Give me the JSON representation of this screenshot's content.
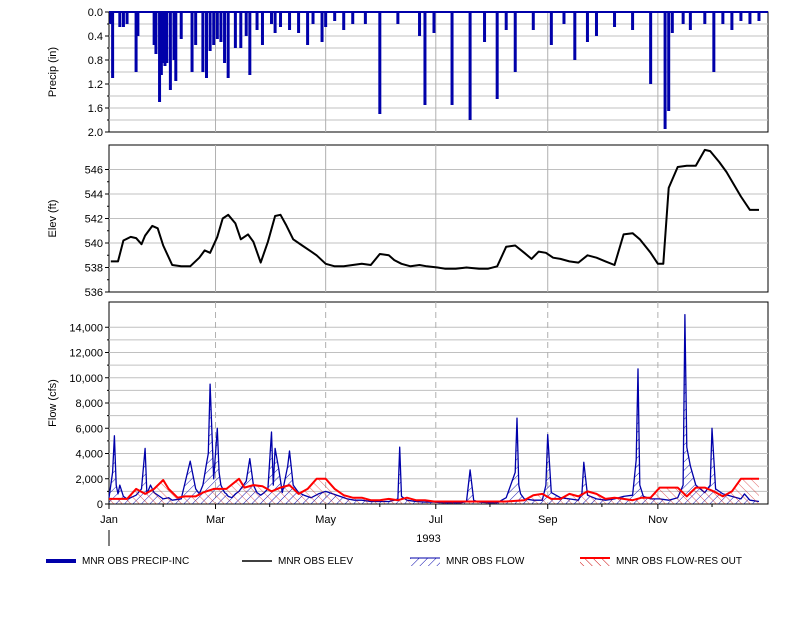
{
  "chart_data": [
    {
      "type": "bar",
      "panel": "precip",
      "ylabel": "Precip (in)",
      "ylim": [
        0,
        2.0
      ],
      "yticks": [
        "0.0",
        "0.4",
        "0.8",
        "1.2",
        "1.6",
        "2.0"
      ],
      "inverted": true,
      "color": "#0000aa",
      "series": [
        {
          "name": "MNR OBS PRECIP-INC",
          "x": [
            1,
            2,
            6,
            8,
            10,
            15,
            16,
            25,
            26,
            28,
            29,
            30,
            31,
            32,
            34,
            36,
            37,
            40,
            46,
            48,
            52,
            54,
            56,
            58,
            60,
            62,
            64,
            66,
            70,
            73,
            76,
            78,
            82,
            85,
            90,
            92,
            95,
            100,
            105,
            110,
            113,
            118,
            120,
            125,
            130,
            135,
            142,
            150,
            160,
            172,
            175,
            180,
            190,
            200,
            208,
            215,
            220,
            225,
            235,
            245,
            252,
            258,
            265,
            270,
            280,
            290,
            300,
            308,
            310,
            312,
            318,
            322,
            330,
            335,
            340,
            345,
            350,
            355,
            360
          ],
          "y": [
            0.2,
            1.1,
            0.25,
            0.25,
            0.2,
            1.0,
            0.4,
            0.55,
            0.7,
            1.5,
            1.05,
            0.85,
            0.9,
            0.85,
            1.3,
            0.8,
            1.15,
            0.45,
            1.0,
            0.55,
            1.0,
            1.1,
            0.65,
            0.55,
            0.45,
            0.5,
            0.85,
            1.1,
            0.6,
            0.6,
            0.4,
            1.05,
            0.3,
            0.55,
            0.2,
            0.35,
            0.25,
            0.3,
            0.35,
            0.55,
            0.2,
            0.5,
            0.25,
            0.15,
            0.3,
            0.2,
            0.2,
            1.7,
            0.2,
            0.4,
            1.55,
            0.35,
            1.55,
            1.8,
            0.5,
            1.45,
            0.3,
            1.0,
            0.3,
            0.55,
            0.2,
            0.8,
            0.5,
            0.4,
            0.25,
            0.3,
            1.2,
            1.95,
            1.65,
            0.35,
            0.2,
            0.3,
            0.2,
            1.0,
            0.2,
            0.3,
            0.15,
            0.2,
            0.15
          ]
        }
      ]
    },
    {
      "type": "line",
      "panel": "elev",
      "ylabel": "Elev (ft)",
      "ylim": [
        536,
        548
      ],
      "yticks": [
        "536",
        "538",
        "540",
        "542",
        "544",
        "546"
      ],
      "color": "#000000",
      "series": [
        {
          "name": "MNR OBS ELEV",
          "x": [
            1,
            5,
            8,
            12,
            15,
            18,
            20,
            24,
            27,
            30,
            35,
            40,
            45,
            50,
            53,
            56,
            60,
            63,
            66,
            70,
            73,
            77,
            80,
            84,
            88,
            92,
            95,
            98,
            102,
            107,
            112,
            115,
            120,
            125,
            130,
            135,
            140,
            145,
            150,
            155,
            158,
            162,
            167,
            172,
            176,
            182,
            186,
            192,
            198,
            205,
            210,
            215,
            220,
            225,
            230,
            234,
            238,
            242,
            246,
            250,
            255,
            260,
            265,
            270,
            275,
            280,
            285,
            290,
            294,
            300,
            304,
            307,
            310,
            315,
            320,
            325,
            330,
            333,
            338,
            342,
            346,
            350,
            355,
            360
          ],
          "y": [
            538.5,
            538.5,
            540.2,
            540.5,
            540.4,
            539.9,
            540.6,
            541.4,
            541.2,
            539.8,
            538.2,
            538.1,
            538.1,
            538.8,
            539.4,
            539.2,
            540.5,
            542.0,
            542.3,
            541.6,
            540.3,
            540.7,
            540.1,
            538.4,
            540.1,
            542.2,
            542.3,
            541.5,
            540.3,
            539.8,
            539.3,
            539.0,
            538.3,
            538.1,
            538.1,
            538.2,
            538.3,
            538.2,
            539.1,
            539.0,
            538.6,
            538.3,
            538.1,
            538.2,
            538.1,
            538.0,
            537.9,
            537.9,
            538.0,
            537.9,
            537.9,
            538.1,
            539.7,
            539.8,
            539.2,
            538.7,
            539.3,
            539.2,
            538.8,
            538.7,
            538.5,
            538.4,
            539.0,
            538.8,
            538.5,
            538.2,
            540.7,
            540.8,
            540.3,
            539.2,
            538.3,
            538.3,
            544.5,
            546.2,
            546.3,
            546.3,
            547.6,
            547.5,
            546.6,
            545.8,
            544.8,
            543.8,
            542.7,
            542.7
          ]
        }
      ]
    },
    {
      "type": "line",
      "panel": "flow",
      "ylabel": "Flow (cfs)",
      "ylim": [
        0,
        16000
      ],
      "yticks": [
        "0",
        "2,000",
        "4,000",
        "6,000",
        "8,000",
        "10,000",
        "12,000",
        "14,000"
      ],
      "xticks": [
        {
          "label": "Jan",
          "day": 0
        },
        {
          "label": "Mar",
          "day": 59
        },
        {
          "label": "May",
          "day": 120
        },
        {
          "label": "Jul",
          "day": 181
        },
        {
          "label": "Sep",
          "day": 243
        },
        {
          "label": "Nov",
          "day": 304
        }
      ],
      "xlabel": "1993",
      "series": [
        {
          "name": "MNR OBS FLOW",
          "color": "#0000aa",
          "x": [
            0,
            2,
            3,
            4,
            5,
            6,
            8,
            10,
            12,
            15,
            18,
            20,
            21,
            23,
            25,
            28,
            30,
            33,
            35,
            40,
            45,
            48,
            50,
            52,
            54,
            55,
            56,
            58,
            60,
            61,
            62,
            63,
            64,
            65,
            66,
            68,
            70,
            72,
            76,
            78,
            80,
            82,
            84,
            86,
            88,
            90,
            91,
            92,
            94,
            96,
            99,
            100,
            102,
            105,
            108,
            112,
            116,
            120,
            124,
            128,
            132,
            136,
            140,
            145,
            150,
            155,
            158,
            160,
            161,
            162,
            165,
            170,
            175,
            180,
            185,
            190,
            195,
            198,
            200,
            202,
            205,
            210,
            215,
            220,
            225,
            226,
            227,
            228,
            230,
            235,
            240,
            242,
            243,
            245,
            250,
            255,
            260,
            262,
            263,
            265,
            270,
            275,
            280,
            285,
            290,
            292,
            293,
            294,
            296,
            300,
            305,
            310,
            315,
            318,
            319,
            320,
            322,
            325,
            330,
            333,
            334,
            336,
            340,
            345,
            350,
            352,
            355,
            360
          ],
          "y": [
            500,
            2500,
            5400,
            1500,
            800,
            1500,
            600,
            400,
            500,
            700,
            1200,
            4400,
            800,
            1500,
            900,
            600,
            400,
            500,
            300,
            400,
            3400,
            1200,
            800,
            1500,
            3200,
            4000,
            9500,
            2000,
            6000,
            2500,
            1500,
            1200,
            900,
            800,
            600,
            500,
            800,
            1000,
            1800,
            3600,
            1500,
            900,
            700,
            900,
            1200,
            5700,
            1500,
            4400,
            2800,
            900,
            3000,
            4200,
            1500,
            900,
            700,
            500,
            800,
            1000,
            800,
            600,
            400,
            300,
            300,
            200,
            200,
            200,
            300,
            400,
            4500,
            600,
            300,
            200,
            150,
            150,
            100,
            100,
            100,
            200,
            2700,
            300,
            150,
            100,
            100,
            500,
            2500,
            6800,
            1500,
            800,
            400,
            300,
            300,
            1500,
            5500,
            900,
            500,
            400,
            300,
            900,
            3300,
            700,
            400,
            300,
            400,
            600,
            700,
            3500,
            10700,
            1500,
            600,
            400,
            400,
            300,
            500,
            1500,
            15000,
            4500,
            3000,
            1500,
            900,
            1500,
            6000,
            1200,
            800,
            600,
            400,
            800,
            300,
            200
          ],
          "hatched": true
        },
        {
          "name": "MNR OBS FLOW-RES OUT",
          "color": "#ff0000",
          "x": [
            0,
            10,
            15,
            20,
            25,
            30,
            33,
            38,
            42,
            48,
            52,
            58,
            65,
            72,
            75,
            80,
            85,
            90,
            95,
            100,
            105,
            110,
            115,
            120,
            125,
            130,
            135,
            140,
            145,
            150,
            155,
            160,
            165,
            170,
            175,
            180,
            190,
            200,
            210,
            220,
            230,
            235,
            240,
            245,
            250,
            255,
            260,
            265,
            270,
            275,
            280,
            285,
            290,
            295,
            300,
            305,
            310,
            315,
            320,
            325,
            330,
            335,
            340,
            345,
            350,
            355,
            360
          ],
          "y": [
            400,
            400,
            1200,
            800,
            1200,
            1900,
            1200,
            500,
            600,
            600,
            900,
            1200,
            1200,
            2000,
            1300,
            1500,
            1400,
            1000,
            1300,
            1500,
            800,
            1200,
            2000,
            2000,
            1200,
            700,
            500,
            500,
            300,
            300,
            400,
            300,
            500,
            300,
            300,
            200,
            200,
            200,
            200,
            200,
            300,
            700,
            800,
            400,
            400,
            800,
            600,
            1000,
            800,
            400,
            500,
            400,
            300,
            500,
            500,
            1300,
            1300,
            1300,
            600,
            1300,
            1300,
            1000,
            600,
            1000,
            2000,
            2000,
            2000
          ]
        }
      ]
    }
  ],
  "legend": {
    "items": [
      {
        "label": "MNR OBS PRECIP-INC",
        "color": "#0000aa",
        "style": "thick"
      },
      {
        "label": "MNR OBS ELEV",
        "color": "#000000",
        "style": "line"
      },
      {
        "label": "MNR OBS FLOW",
        "color": "#0000aa",
        "style": "hatched"
      },
      {
        "label": "MNR OBS FLOW-RES OUT",
        "color": "#ff0000",
        "style": "hatched-red"
      }
    ]
  }
}
